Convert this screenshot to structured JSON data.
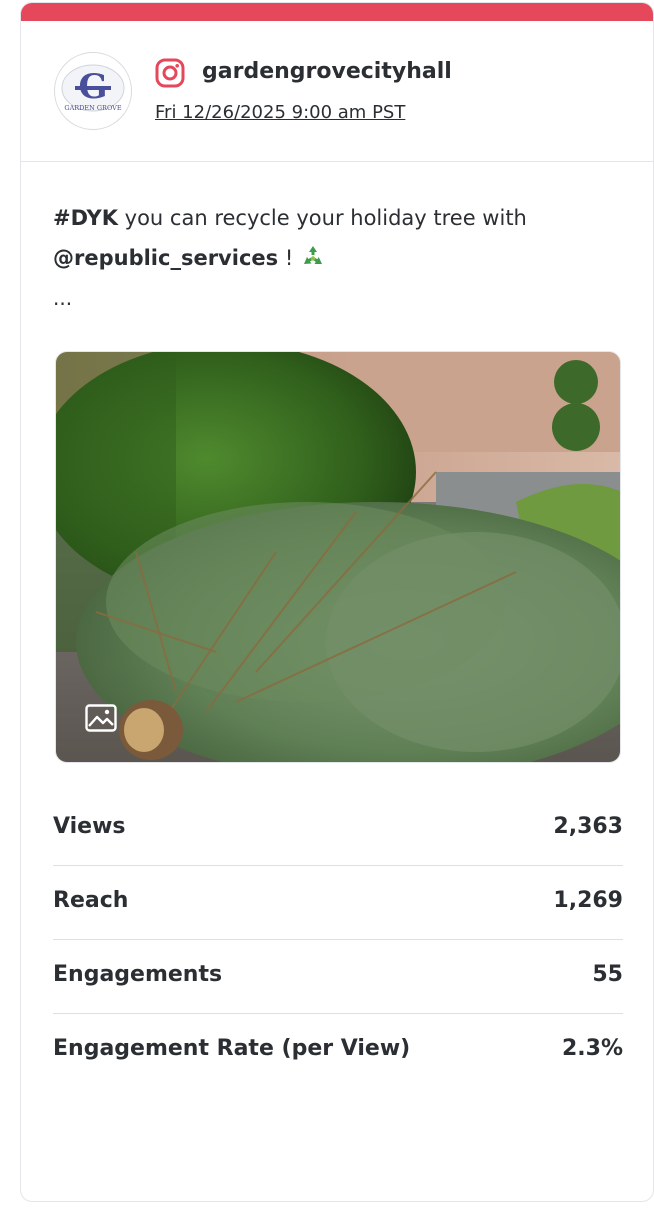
{
  "post": {
    "account": "gardengrovecityhall",
    "timestamp": "Fri 12/26/2025 9:00 am PST",
    "network_icon": "instagram-icon",
    "brand_color": "#e5475b",
    "avatar_logo_text": "GARDEN GROVE",
    "caption": {
      "hashtag": "#DYK",
      "text_1": " you can recycle your holiday tree with",
      "mention": "@republic_services",
      "text_2": " ! ",
      "emoji": "♻️",
      "ellipsis": "..."
    },
    "media_type_icon": "image-icon"
  },
  "metrics": [
    {
      "label": "Views",
      "value": "2,363"
    },
    {
      "label": "Reach",
      "value": "1,269"
    },
    {
      "label": "Engagements",
      "value": "55"
    },
    {
      "label": "Engagement Rate (per View)",
      "value": "2.3%"
    }
  ]
}
